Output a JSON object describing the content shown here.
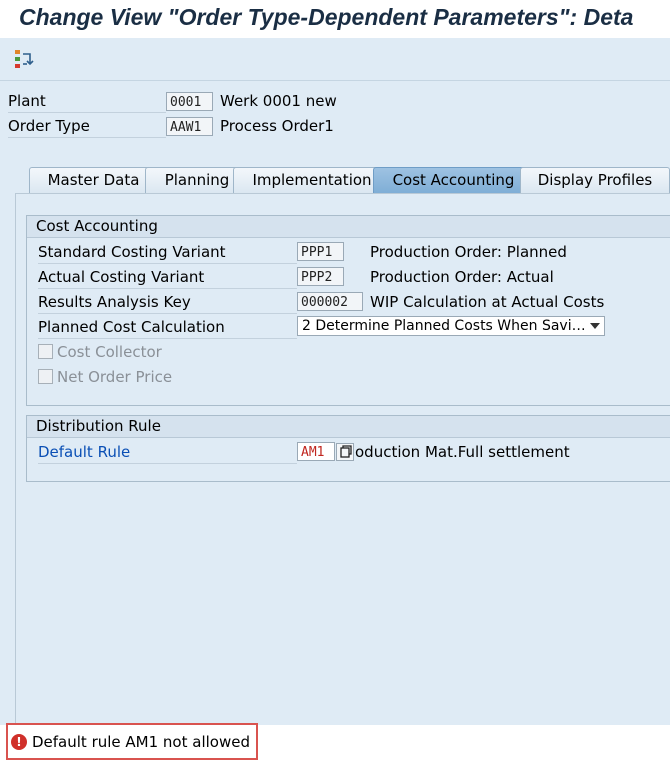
{
  "window": {
    "title": "Change View \"Order Type-Dependent Parameters\": Deta"
  },
  "toolbar": {
    "icon": "hierarchy-switch-icon"
  },
  "header": {
    "plant": {
      "label": "Plant",
      "value": "0001",
      "description": "Werk 0001 new"
    },
    "order_type": {
      "label": "Order Type",
      "value": "AAW1",
      "description": "Process Order1"
    }
  },
  "tabs": [
    {
      "label": "Master Data",
      "active": false
    },
    {
      "label": "Planning",
      "active": false
    },
    {
      "label": "Implementation",
      "active": false
    },
    {
      "label": "Cost Accounting",
      "active": true
    },
    {
      "label": "Display Profiles",
      "active": false
    }
  ],
  "cost_accounting": {
    "title": "Cost Accounting",
    "standard_costing_variant": {
      "label": "Standard Costing Variant",
      "value": "PPP1",
      "description": "Production Order: Planned"
    },
    "actual_costing_variant": {
      "label": "Actual Costing Variant",
      "value": "PPP2",
      "description": "Production Order: Actual"
    },
    "results_analysis_key": {
      "label": "Results Analysis Key",
      "value": "000002",
      "description": "WIP Calculation at Actual Costs"
    },
    "planned_cost_calculation": {
      "label": "Planned Cost Calculation",
      "value": "2 Determine Planned Costs When Savi…"
    },
    "cost_collector": {
      "label": "Cost Collector",
      "checked": false
    },
    "net_order_price": {
      "label": "Net Order Price",
      "checked": false
    }
  },
  "distribution_rule": {
    "title": "Distribution Rule",
    "default_rule": {
      "label": "Default Rule",
      "value": "AM1",
      "description": "oduction Mat.Full settlement"
    }
  },
  "status": {
    "type": "error",
    "message": "Default rule AM1 not allowed",
    "icon": "error-icon"
  },
  "colors": {
    "error": "#d0302a",
    "link": "#0a4fb5",
    "active_tab": "#8fb8dc"
  }
}
